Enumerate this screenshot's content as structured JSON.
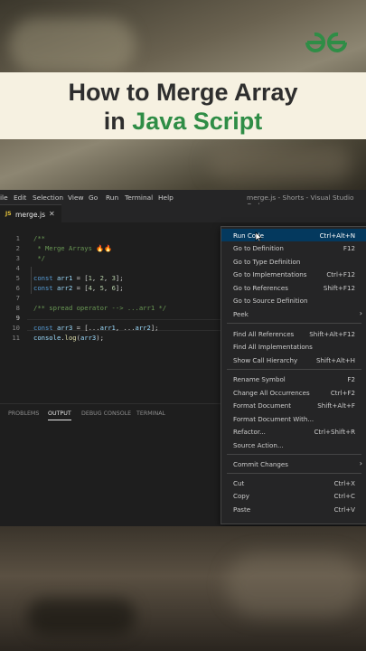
{
  "banner": {
    "title_line1": "How to Merge Array",
    "title_line2a": "in ",
    "title_line2b": "Java Script",
    "accent_color": "#2f8d46",
    "logo_icon": "gfg-logo-icon"
  },
  "menubar": {
    "items": [
      "ile",
      "Edit",
      "Selection",
      "View",
      "Go",
      "Run",
      "Terminal",
      "Help"
    ],
    "window_title": "merge.js - Shorts - Visual Studio Code"
  },
  "tab": {
    "badge": "JS",
    "name": "merge.js",
    "close": "✕"
  },
  "editor": {
    "line_numbers": [
      "1",
      "2",
      "3",
      "4",
      "5",
      "6",
      "7",
      "8",
      "9",
      "10",
      "11"
    ]
  },
  "panel": {
    "tabs": [
      "PROBLEMS",
      "OUTPUT",
      "DEBUG CONSOLE",
      "TERMINAL"
    ],
    "active": "OUTPUT"
  },
  "context_menu": {
    "items": [
      {
        "label": "Run Code",
        "key": "Ctrl+Alt+N",
        "highlighted": true
      },
      {
        "label": "Go to Definition",
        "key": "F12"
      },
      {
        "label": "Go to Type Definition",
        "key": ""
      },
      {
        "label": "Go to Implementations",
        "key": "Ctrl+F12"
      },
      {
        "label": "Go to References",
        "key": "Shift+F12"
      },
      {
        "label": "Go to Source Definition",
        "key": ""
      },
      {
        "label": "Peek",
        "key": "",
        "submenu": true
      },
      {
        "label": "Find All References",
        "key": "Shift+Alt+F12"
      },
      {
        "label": "Find All Implementations",
        "key": ""
      },
      {
        "label": "Show Call Hierarchy",
        "key": "Shift+Alt+H"
      },
      {
        "label": "Rename Symbol",
        "key": "F2"
      },
      {
        "label": "Change All Occurrences",
        "key": "Ctrl+F2"
      },
      {
        "label": "Format Document",
        "key": "Shift+Alt+F"
      },
      {
        "label": "Format Document With...",
        "key": ""
      },
      {
        "label": "Refactor...",
        "key": "Ctrl+Shift+R"
      },
      {
        "label": "Source Action...",
        "key": ""
      },
      {
        "label": "Commit Changes",
        "key": "",
        "submenu": true
      },
      {
        "label": "Cut",
        "key": "Ctrl+X"
      },
      {
        "label": "Copy",
        "key": "Ctrl+C"
      },
      {
        "label": "Paste",
        "key": "Ctrl+V"
      }
    ]
  }
}
